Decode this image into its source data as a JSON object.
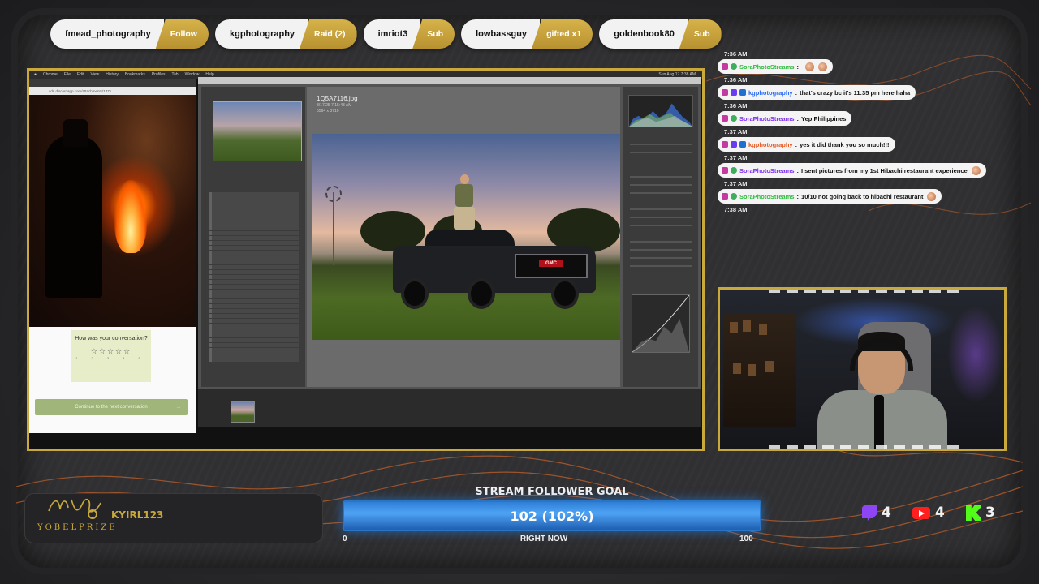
{
  "alerts": [
    {
      "name": "fmead_photography",
      "type": "Follow"
    },
    {
      "name": "kgphotography",
      "type": "Raid (2)"
    },
    {
      "name": "imriot3",
      "type": "Sub"
    },
    {
      "name": "lowbassguy",
      "type": "gifted x1"
    },
    {
      "name": "goldenbook80",
      "type": "Sub"
    }
  ],
  "screen": {
    "menu_clock": "Sun Aug 17 7:38 AM",
    "menu_items": [
      "Chrome",
      "File",
      "Edit",
      "View",
      "History",
      "Bookmarks",
      "Profiles",
      "Tab",
      "Window",
      "Help"
    ],
    "browser": {
      "url": "cdn.discordapp.com/attachments/1471...",
      "rating_question": "How was your conversation?",
      "stars": "☆☆☆☆☆",
      "star_numbers": "1 2 3 4 5",
      "continue_label": "Continue to the next conversation",
      "continue_arrow": "→"
    },
    "lightroom": {
      "filename": "1Q5A7116.jpg",
      "file_date": "8/17/25 7:15:43 AM",
      "file_dims": "5564 x 3710"
    }
  },
  "chat": [
    {
      "time": "7:36 AM",
      "user": "SoraPhotoStreams",
      "user_color": "green",
      "badges": [
        "pink",
        "green"
      ],
      "text": "",
      "emotes": 2
    },
    {
      "time": "7:36 AM",
      "user": "kgphotography",
      "user_color": "blue",
      "badges": [
        "pink",
        "purple",
        "blue"
      ],
      "text": "that's crazy bc it's 11:35 pm here haha",
      "emotes": 0
    },
    {
      "time": "7:36 AM",
      "user": "SoraPhotoStreams",
      "user_color": "purple",
      "badges": [
        "pink",
        "green"
      ],
      "text": "Yep Philippines",
      "emotes": 0
    },
    {
      "time": "7:37 AM",
      "user": "kgphotography",
      "user_color": "red",
      "badges": [
        "pink",
        "purple",
        "blue"
      ],
      "text": "yes it did thank you so much!!!",
      "emotes": 0
    },
    {
      "time": "7:37 AM",
      "user": "SoraPhotoStreams",
      "user_color": "purple",
      "badges": [
        "pink",
        "green"
      ],
      "text": "I sent pictures from my 1st Hibachi restaurant experience",
      "emotes": 1
    },
    {
      "time": "7:37 AM",
      "user": "SoraPhotoStreams",
      "user_color": "green",
      "badges": [
        "pink",
        "green"
      ],
      "text": "10/10 not going back to hibachi restaurant",
      "emotes": 1
    }
  ],
  "chat_last_time": "7:38 AM",
  "branding": {
    "logo_text": "YOBELPRIZE",
    "handle": "KYIRL123"
  },
  "goal": {
    "title": "STREAM FOLLOWER GOAL",
    "value_text": "102 (102%)",
    "progress": 1.0,
    "min": "0",
    "max": "100",
    "subtitle": "RIGHT NOW"
  },
  "social": {
    "twitch_count": "4",
    "youtube_count": "4",
    "kick_count": "3"
  },
  "colors": {
    "accent_gold": "#c9a83c",
    "goal_blue": "#2a76c4"
  }
}
